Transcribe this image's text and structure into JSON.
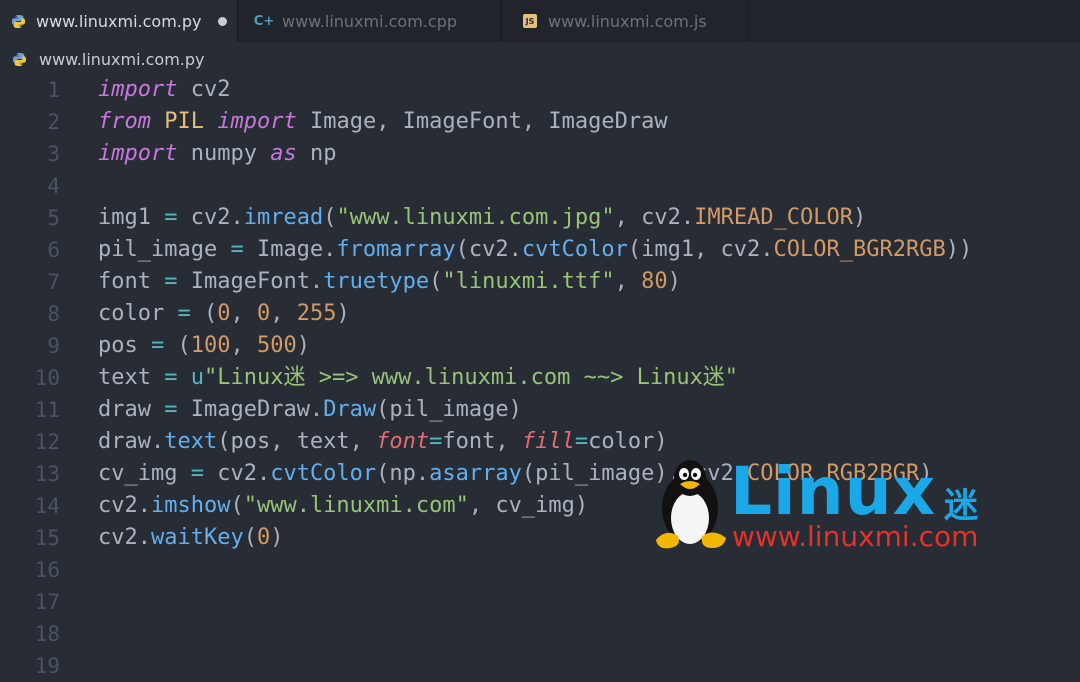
{
  "tabs": [
    {
      "label": "www.linuxmi.com.py",
      "icon": "python-icon",
      "active": true,
      "modified": true
    },
    {
      "label": "www.linuxmi.com.cpp",
      "icon": "cpp-icon",
      "active": false
    },
    {
      "label": "www.linuxmi.com.js",
      "icon": "js-icon",
      "active": false
    }
  ],
  "breadcrumb": {
    "file": "www.linuxmi.com.py",
    "icon": "python-icon"
  },
  "editor": {
    "line_numbers": [
      "1",
      "2",
      "3",
      "4",
      "5",
      "6",
      "7",
      "8",
      "9",
      "10",
      "11",
      "12",
      "13",
      "14",
      "15",
      "16",
      "17",
      "18",
      "19"
    ],
    "lines": [
      "import cv2",
      "from PIL import Image, ImageFont, ImageDraw",
      "import numpy as np",
      "",
      "img1 = cv2.imread(\"www.linuxmi.com.jpg\", cv2.IMREAD_COLOR)",
      "pil_image = Image.fromarray(cv2.cvtColor(img1, cv2.COLOR_BGR2RGB))",
      "font = ImageFont.truetype(\"linuxmi.ttf\", 80)",
      "color = (0, 0, 255)",
      "pos = (100, 500)",
      "text = u\"Linux迷 >=> www.linuxmi.com ~~> Linux迷\"",
      "draw = ImageDraw.Draw(pil_image)",
      "draw.text(pos, text, font=font, fill=color)",
      "cv_img = cv2.cvtColor(np.asarray(pil_image), cv2.COLOR_RGB2BGR)",
      "cv2.imshow(\"www.linuxmi.com\", cv_img)",
      "cv2.waitKey(0)",
      "",
      "",
      "",
      ""
    ]
  },
  "watermark": {
    "brand": "Linux",
    "brand_cn": "迷",
    "site": "www.linuxmi.com"
  }
}
